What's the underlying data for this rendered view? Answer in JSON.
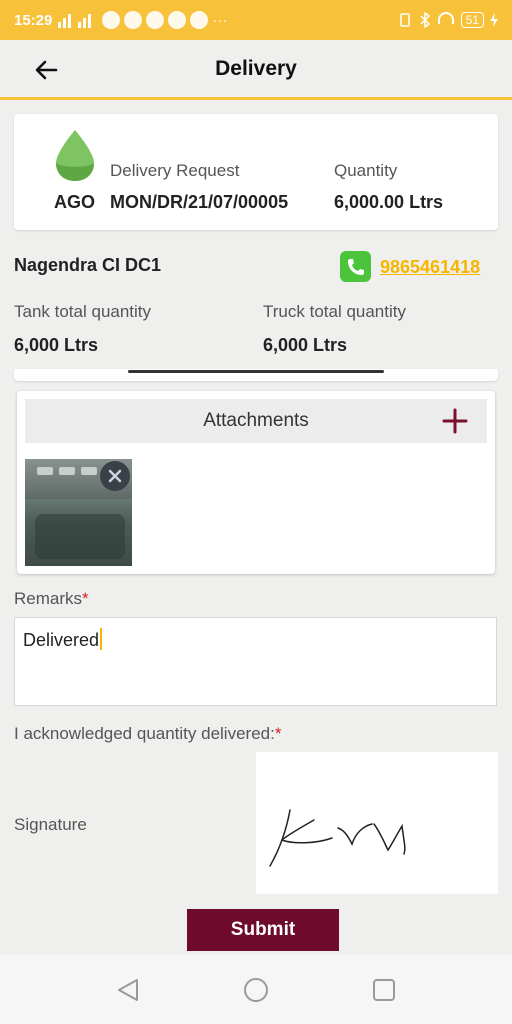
{
  "status_bar": {
    "time": "15:29",
    "battery": "51"
  },
  "header": {
    "title": "Delivery",
    "back_icon": "arrow-left-icon"
  },
  "order": {
    "product": "AGO",
    "product_icon": "drop-icon",
    "delivery_request_label": "Delivery Request",
    "delivery_request": "MON/DR/21/07/00005",
    "quantity_label": "Quantity",
    "quantity": "6,000.00 Ltrs"
  },
  "station": {
    "name": "Nagendra CI DC1",
    "phone": "9865461418"
  },
  "totals": {
    "tank_label": "Tank total quantity",
    "tank_value": "6,000 Ltrs",
    "truck_label": "Truck total quantity",
    "truck_value": "6,000 Ltrs"
  },
  "attachments": {
    "title": "Attachments"
  },
  "remarks": {
    "label": "Remarks",
    "required_mark": "*",
    "value": "Delivered"
  },
  "acknowledge": {
    "label": "I acknowledged quantity delivered:",
    "required_mark": "*"
  },
  "signature": {
    "label": "Signature"
  },
  "submit_label": "Submit",
  "colors": {
    "accent": "#f7c23a",
    "primary": "#6e0a2b",
    "phone_green": "#4bc43c",
    "link": "#f7b500"
  }
}
